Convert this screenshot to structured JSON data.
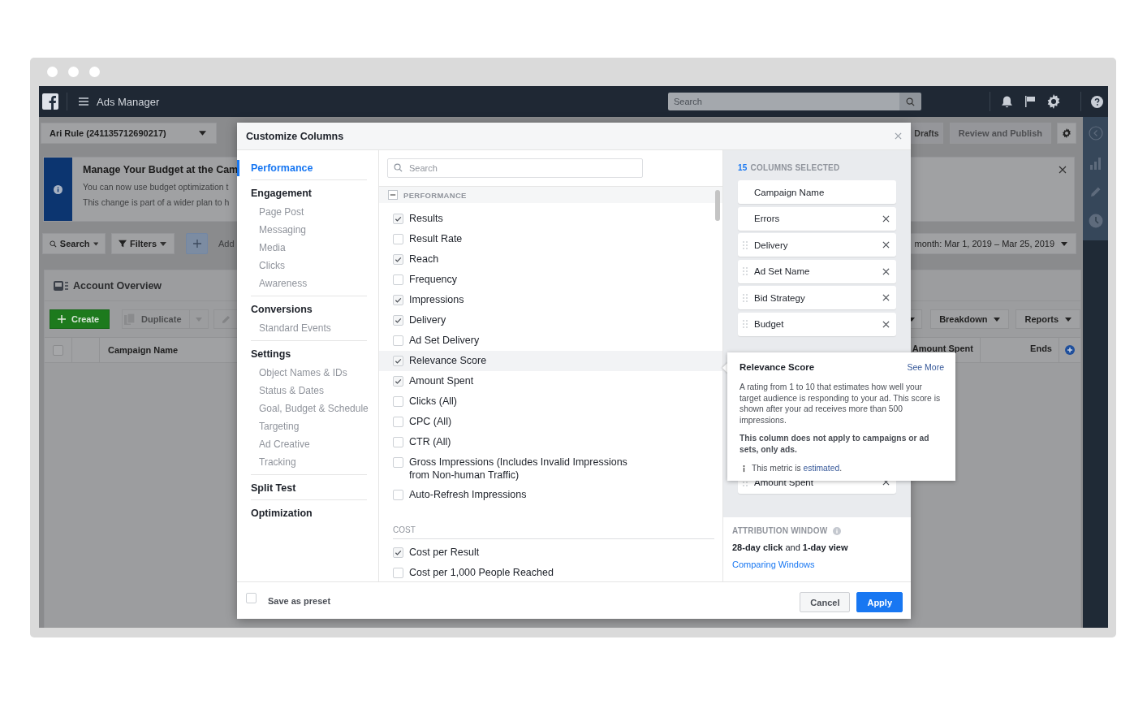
{
  "topbar": {
    "title": "Ads Manager",
    "search": {
      "placeholder": "Search"
    }
  },
  "account_selector": {
    "value": "Ari Rule (241135712690217)"
  },
  "header_buttons": [
    "Drafts",
    "Review and Publish"
  ],
  "banner": {
    "title": "Manage Your Budget at the Cam",
    "lines": [
      "You can now use budget optimization t",
      "This change is part of a wider plan to h"
    ]
  },
  "filter_bar": {
    "buttons": [
      "Search",
      "Filters"
    ],
    "add_label": "Add",
    "date_range": "month: Mar 1, 2019 – Mar 25, 2019"
  },
  "account_overview": {
    "title": "Account Overview",
    "create": "Create",
    "duplicate": "Duplicate",
    "right_buttons": [
      "Breakdown",
      "Reports"
    ],
    "select_all_checked": false,
    "columns_left": [
      "Campaign Name"
    ],
    "columns_right": [
      "Amount Spent",
      "Ends"
    ]
  },
  "modal": {
    "title": "Customize Columns",
    "nav": [
      {
        "label": "Performance",
        "selected": true
      },
      {
        "label": "Engagement",
        "selected": false,
        "children": [
          {
            "label": "Page Post",
            "selected": false
          },
          {
            "label": "Messaging",
            "selected": false
          },
          {
            "label": "Media",
            "selected": false
          },
          {
            "label": "Clicks",
            "selected": false
          },
          {
            "label": "Awareness",
            "selected": false
          }
        ]
      },
      {
        "label": "Conversions",
        "selected": false,
        "children": [
          {
            "label": "Standard Events",
            "selected": false
          }
        ]
      },
      {
        "label": "Settings",
        "selected": false,
        "children": [
          {
            "label": "Object Names & IDs",
            "selected": false
          },
          {
            "label": "Status & Dates",
            "selected": false
          },
          {
            "label": "Goal, Budget & Schedule",
            "selected": false
          },
          {
            "label": "Targeting",
            "selected": false
          },
          {
            "label": "Ad Creative",
            "selected": false
          },
          {
            "label": "Tracking",
            "selected": false
          }
        ]
      },
      {
        "label": "Split Test",
        "selected": false
      },
      {
        "label": "Optimization",
        "selected": false
      }
    ],
    "search": {
      "placeholder": "Search"
    },
    "sections": [
      {
        "title": "PERFORMANCE",
        "kind": "collapsible",
        "expanded": true,
        "items": [
          {
            "label": "Results",
            "checked": true,
            "highlighted": false
          },
          {
            "label": "Result Rate",
            "checked": false,
            "highlighted": false
          },
          {
            "label": "Reach",
            "checked": true,
            "highlighted": false
          },
          {
            "label": "Frequency",
            "checked": false,
            "highlighted": false
          },
          {
            "label": "Impressions",
            "checked": true,
            "highlighted": false
          },
          {
            "label": "Delivery",
            "checked": true,
            "highlighted": false
          },
          {
            "label": "Ad Set Delivery",
            "checked": false,
            "highlighted": false
          },
          {
            "label": "Relevance Score",
            "checked": true,
            "highlighted": true
          },
          {
            "label": "Amount Spent",
            "checked": true,
            "highlighted": false
          },
          {
            "label": "Clicks (All)",
            "checked": false,
            "highlighted": false
          },
          {
            "label": "CPC (All)",
            "checked": false,
            "highlighted": false
          },
          {
            "label": "CTR (All)",
            "checked": false,
            "highlighted": false
          },
          {
            "label": "Gross Impressions (Includes Invalid Impressions from Non-human Traffic)",
            "checked": false,
            "highlighted": false
          },
          {
            "label": "Auto-Refresh Impressions",
            "checked": false,
            "highlighted": false
          }
        ]
      },
      {
        "title": "COST",
        "kind": "plain",
        "items": [
          {
            "label": "Cost per Result",
            "checked": true,
            "highlighted": false
          },
          {
            "label": "Cost per 1,000 People Reached",
            "checked": false,
            "highlighted": false
          }
        ]
      }
    ],
    "selected_count": "15",
    "selected_label": "COLUMNS SELECTED",
    "selected_columns": [
      {
        "label": "Campaign Name",
        "draggable": false,
        "removable": false
      },
      {
        "label": "Errors",
        "draggable": false,
        "removable": true
      },
      {
        "label": "Delivery",
        "draggable": true,
        "removable": true
      },
      {
        "label": "Ad Set Name",
        "draggable": true,
        "removable": true
      },
      {
        "label": "Bid Strategy",
        "draggable": true,
        "removable": true
      },
      {
        "label": "Budget",
        "draggable": true,
        "removable": true
      }
    ],
    "selected_columns_lower": [
      {
        "label": "Amount Spent",
        "draggable": true,
        "removable": true
      }
    ],
    "tooltip": {
      "title": "Relevance Score",
      "link": "See More",
      "text": "A rating from 1 to 10 that estimates how well your target audience is responding to your ad. This score is shown after your ad receives more than 500 impressions.",
      "note": "This column does not apply to campaigns or ad sets, only ads.",
      "metric_prefix": "This metric is ",
      "metric_link": "estimated",
      "metric_suffix": "."
    },
    "attribution": {
      "title": "ATTRIBUTION WINDOW",
      "value": "**28-day click** and **1-day view**",
      "link": "Comparing Windows"
    },
    "footer": {
      "preset_label": "Save as preset",
      "preset_checked": false,
      "buttons": [
        {
          "label": "Cancel",
          "kind": "secondary"
        },
        {
          "label": "Apply",
          "kind": "primary"
        }
      ]
    }
  }
}
